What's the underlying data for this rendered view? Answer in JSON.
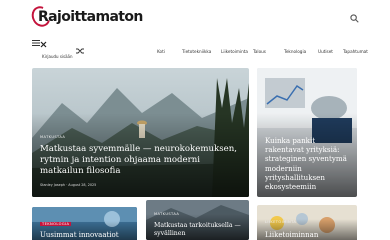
{
  "header": {
    "logo_text": "Rajoittamaton"
  },
  "nav": {
    "menu_label": "Kirjaudu sisään",
    "links": [
      "Koti",
      "Tietotekniikka",
      "Liiketoiminta",
      "Talous",
      "Teknologia",
      "Uutiset",
      "Tapahtumat"
    ]
  },
  "featured": {
    "category": "MATKUSTAA",
    "title": "Matkustaa syvemmälle — neurokokemuksen, rytmin ja intention ohjaama moderni matkailun filosofia",
    "meta": "Stanley Joseph · August 28, 2025"
  },
  "side_card": {
    "title": "Kuinka pankit rakentavat yrityksiä: strateginen syventymä moderniin yrityshallituksen ekosysteemiin"
  },
  "bottom_cards": [
    {
      "category": "TEKNOLOGIA",
      "title": "Uusimmat innovaatiot"
    },
    {
      "category": "MATKUSTAA",
      "title": "Matkustaa tarkoituksella — syvällinen"
    },
    {
      "category": "LIIKETOIMINTA",
      "title": "Liiketoiminnan"
    }
  ]
}
